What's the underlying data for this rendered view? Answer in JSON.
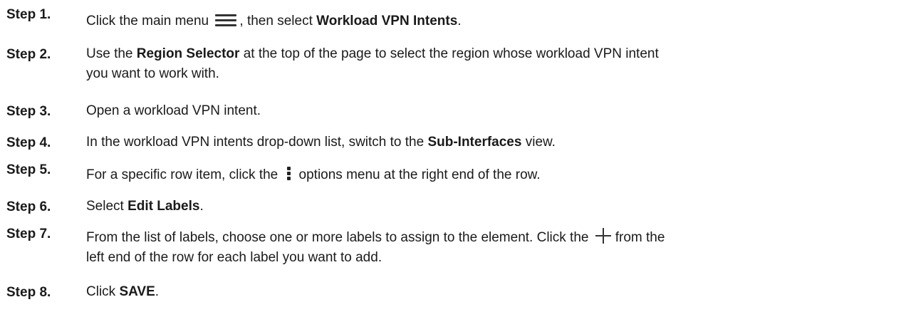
{
  "steps": [
    {
      "label": "Step 1.",
      "pre": "Click the main menu",
      "icon": "menu-icon",
      "mid": ", then select ",
      "bold": "Workload VPN Intents",
      "post": "."
    },
    {
      "label": "Step 2.",
      "pre": "Use the ",
      "bold": "Region Selector",
      "post": " at the top of the page to select the region whose workload VPN intent",
      "line2": "you want to work with."
    },
    {
      "label": "Step 3.",
      "text": "Open a workload VPN intent."
    },
    {
      "label": "Step 4.",
      "pre": "In the workload VPN intents drop-down list, switch to the ",
      "bold": "Sub-Interfaces",
      "post": " view."
    },
    {
      "label": "Step 5.",
      "pre": "For a specific row item, click the",
      "icon": "kebab-menu-icon",
      "post": "options menu at the right end of the row."
    },
    {
      "label": "Step 6.",
      "pre": "Select ",
      "bold": "Edit Labels",
      "post": "."
    },
    {
      "label": "Step 7.",
      "pre": "From the list of labels, choose one or more labels to assign to the element. Click the",
      "icon": "plus-icon",
      "post": "from the",
      "line2": "left end of the row for each label you want to add."
    },
    {
      "label": "Step 8.",
      "pre": "Click ",
      "bold": "SAVE",
      "post": "."
    }
  ]
}
